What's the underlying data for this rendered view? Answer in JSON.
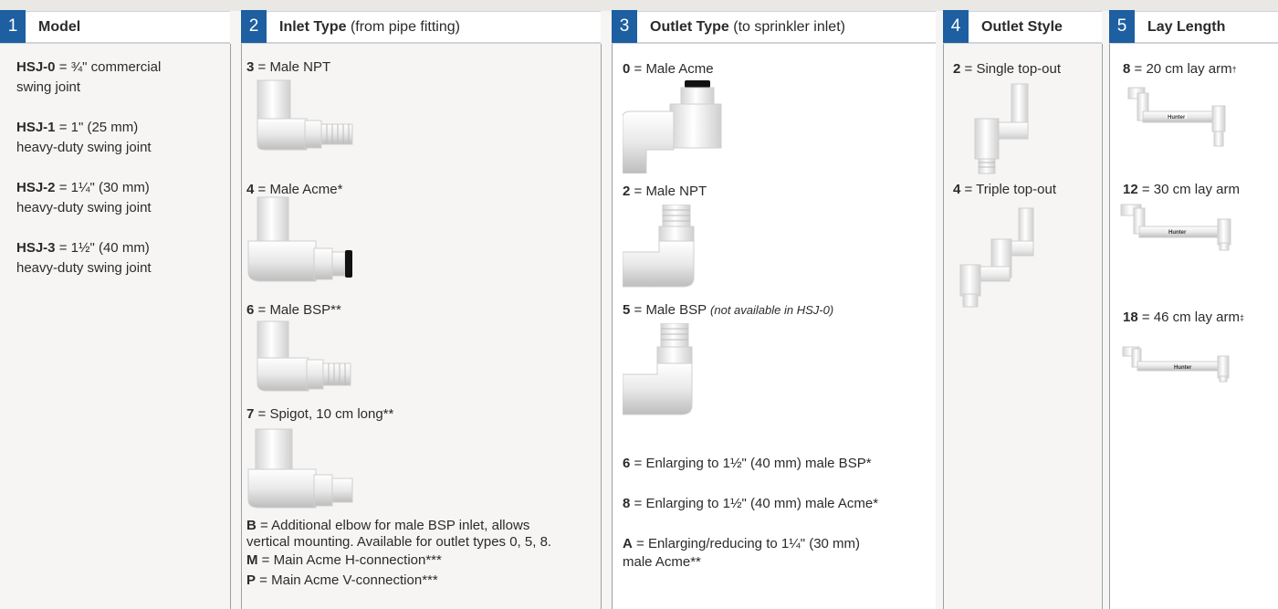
{
  "columns": [
    {
      "num": "1",
      "title": "Model",
      "subtitle": ""
    },
    {
      "num": "2",
      "title": "Inlet Type",
      "subtitle": " (from pipe fitting)"
    },
    {
      "num": "3",
      "title": "Outlet Type",
      "subtitle": " (to sprinkler inlet)"
    },
    {
      "num": "4",
      "title": "Outlet Style",
      "subtitle": ""
    },
    {
      "num": "5",
      "title": "Lay Length",
      "subtitle": ""
    }
  ],
  "models": [
    {
      "code": "HSJ-0",
      "line1": " = ¾\" commercial",
      "line2": "swing joint"
    },
    {
      "code": "HSJ-1",
      "line1": " = 1\" (25 mm)",
      "line2": "heavy-duty swing joint"
    },
    {
      "code": "HSJ-2",
      "line1": " = 1¼\" (30 mm)",
      "line2": "heavy-duty swing joint"
    },
    {
      "code": "HSJ-3",
      "line1": " = 1½\" (40 mm)",
      "line2": "heavy-duty swing joint"
    }
  ],
  "inlets": [
    {
      "code": "3",
      "desc": " = Male NPT"
    },
    {
      "code": "4",
      "desc": " = Male Acme*"
    },
    {
      "code": "6",
      "desc": " = Male BSP**"
    },
    {
      "code": "7",
      "desc": " = Spigot, 10 cm long**"
    }
  ],
  "inlet_extra": [
    {
      "code": "B",
      "line1": "  = Additional elbow for male BSP inlet, allows",
      "line2": "vertical mounting.  Available for outlet types 0, 5, 8."
    },
    {
      "code": "M",
      "line1": "  = Main Acme H-connection***"
    },
    {
      "code": "P",
      "line1": "  = Main Acme V-connection***"
    }
  ],
  "outlets": [
    {
      "code": "0",
      "desc": "  = Male Acme",
      "note": ""
    },
    {
      "code": "2",
      "desc": "  = Male NPT",
      "note": ""
    },
    {
      "code": "5",
      "desc": "  = Male BSP ",
      "note": "(not available in HSJ-0)"
    },
    {
      "code": "6",
      "desc": "  = Enlarging to 1½\" (40 mm) male BSP*",
      "note": ""
    },
    {
      "code": "8",
      "desc": "  = Enlarging to 1½\" (40 mm) male Acme*",
      "note": ""
    },
    {
      "code": "A",
      "desc": "  = Enlarging/reducing to 1¼\" (30 mm)",
      "line2": "male Acme**"
    }
  ],
  "styles": [
    {
      "code": "2",
      "desc": "  = Single top-out"
    },
    {
      "code": "4",
      "desc": "  = Triple top-out"
    }
  ],
  "lengths": [
    {
      "code": "8",
      "desc": " = 20 cm lay arm",
      "mark": "†"
    },
    {
      "code": "12",
      "desc": " = 30 cm lay arm",
      "mark": ""
    },
    {
      "code": "18",
      "desc": " = 46 cm lay arm",
      "mark": "‡"
    }
  ],
  "brand": "Hunter",
  "colors": {
    "accent": "#1d5fa1",
    "fitting": "#ffffff",
    "fitting_shade": "#d9d9d9",
    "oring": "#111111"
  }
}
